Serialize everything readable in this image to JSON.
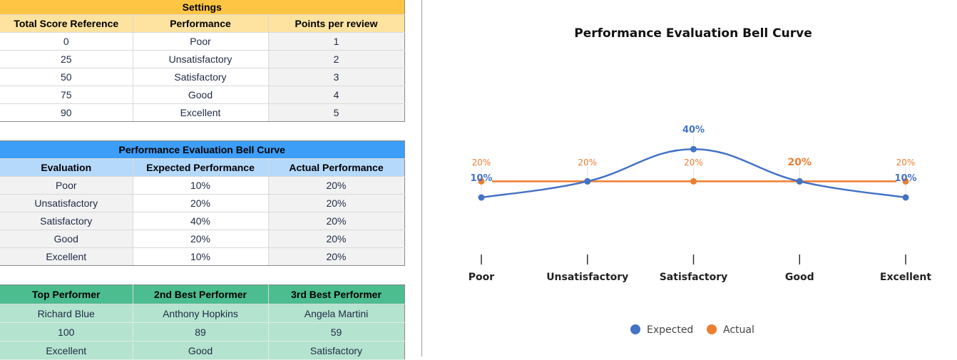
{
  "settings": {
    "title": "Settings",
    "headers": [
      "Total Score Reference",
      "Performance",
      "Points per review"
    ],
    "rows": [
      [
        "0",
        "Poor",
        "1"
      ],
      [
        "25",
        "Unsatisfactory",
        "2"
      ],
      [
        "50",
        "Satisfactory",
        "3"
      ],
      [
        "75",
        "Good",
        "4"
      ],
      [
        "90",
        "Excellent",
        "5"
      ]
    ]
  },
  "bell_table": {
    "title": "Performance Evaluation Bell Curve",
    "headers": [
      "Evaluation",
      "Expected Performance",
      "Actual Performance"
    ],
    "rows": [
      [
        "Poor",
        "10%",
        "20%"
      ],
      [
        "Unsatisfactory",
        "20%",
        "20%"
      ],
      [
        "Satisfactory",
        "40%",
        "20%"
      ],
      [
        "Good",
        "20%",
        "20%"
      ],
      [
        "Excellent",
        "10%",
        "20%"
      ]
    ]
  },
  "top_performers": {
    "headers": [
      "Top Performer",
      "2nd Best Performer",
      "3rd Best Performer"
    ],
    "rows": [
      [
        "Richard Blue",
        "Anthony Hopkins",
        "Angela Martini"
      ],
      [
        "100",
        "89",
        "59"
      ],
      [
        "Excellent",
        "Good",
        "Satisfactory"
      ]
    ]
  },
  "chart_data": {
    "type": "line",
    "title": "Performance Evaluation Bell Curve",
    "categories": [
      "Poor",
      "Unsatisfactory",
      "Satisfactory",
      "Good",
      "Excellent"
    ],
    "series": [
      {
        "name": "Expected",
        "values": [
          0.1,
          0.2,
          0.4,
          0.2,
          0.1
        ],
        "labels": [
          "10%",
          "20%",
          "40%",
          "20%",
          "10%"
        ],
        "color": "#4472c4",
        "smooth": true
      },
      {
        "name": "Actual",
        "values": [
          0.2,
          0.2,
          0.2,
          0.2,
          0.2
        ],
        "labels": [
          "20%",
          "20%",
          "20%",
          "20%",
          "20%"
        ],
        "color": "#ed7d31",
        "smooth": false
      }
    ],
    "xlabel": "",
    "ylabel": "",
    "ylim": [
      0,
      0.5
    ],
    "grid": false,
    "legend_position": "bottom"
  }
}
